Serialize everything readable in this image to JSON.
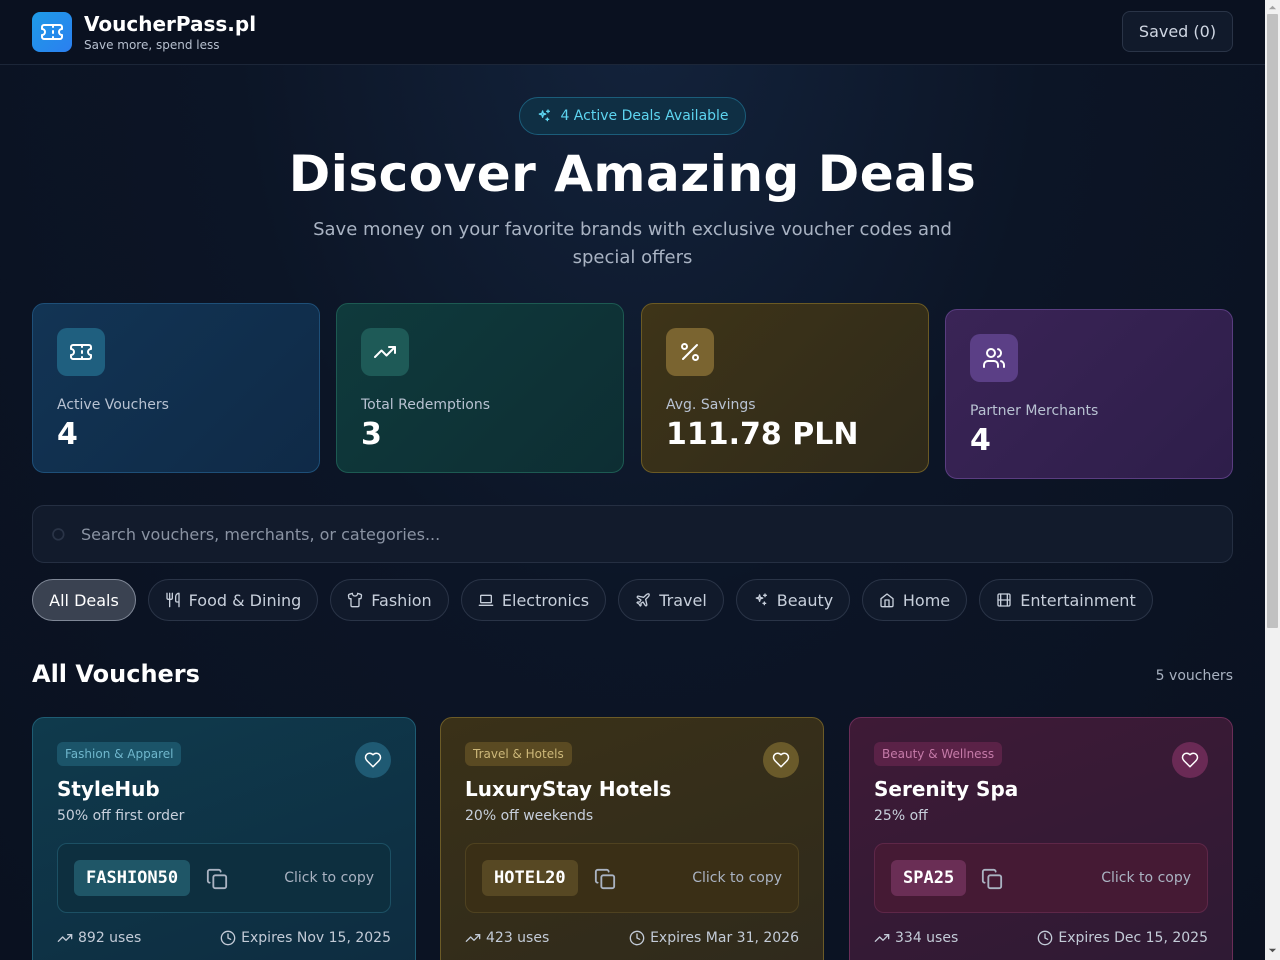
{
  "header": {
    "brand_name": "VoucherPass.pl",
    "tagline": "Save more, spend less",
    "saved_label": "Saved (0)",
    "logo_icon": "ticket-icon"
  },
  "hero": {
    "pill_label": "4 Active Deals Available",
    "title": "Discover Amazing Deals",
    "subtitle": "Save money on your favorite brands with exclusive voucher codes and special offers"
  },
  "stats": [
    {
      "label": "Active Vouchers",
      "value": "4",
      "icon": "ticket-icon"
    },
    {
      "label": "Total Redemptions",
      "value": "3",
      "icon": "trending-up-icon"
    },
    {
      "label": "Avg. Savings",
      "value": "111.78 PLN",
      "icon": "percent-icon"
    },
    {
      "label": "Partner Merchants",
      "value": "4",
      "icon": "users-icon"
    }
  ],
  "search": {
    "placeholder": "Search vouchers, merchants, or categories...",
    "value": ""
  },
  "categories": [
    {
      "label": "All Deals",
      "icon": "",
      "active": true
    },
    {
      "label": "Food & Dining",
      "icon": "utensils-icon"
    },
    {
      "label": "Fashion",
      "icon": "shirt-icon"
    },
    {
      "label": "Electronics",
      "icon": "laptop-icon"
    },
    {
      "label": "Travel",
      "icon": "plane-icon"
    },
    {
      "label": "Beauty",
      "icon": "sparkles-icon"
    },
    {
      "label": "Home",
      "icon": "home-icon"
    },
    {
      "label": "Entertainment",
      "icon": "film-icon"
    }
  ],
  "vouchers_section": {
    "title": "All Vouchers",
    "count": "5 vouchers"
  },
  "vouchers": [
    {
      "category": "Fashion & Apparel",
      "merchant": "StyleHub",
      "offer": "50% off first order",
      "code": "FASHION50",
      "copy_hint": "Click to copy",
      "uses": "892 uses",
      "expires": "Expires Nov 15, 2025"
    },
    {
      "category": "Travel & Hotels",
      "merchant": "LuxuryStay Hotels",
      "offer": "20% off weekends",
      "code": "HOTEL20",
      "copy_hint": "Click to copy",
      "uses": "423 uses",
      "expires": "Expires Mar 31, 2026"
    },
    {
      "category": "Beauty & Wellness",
      "merchant": "Serenity Spa",
      "offer": "25% off",
      "code": "SPA25",
      "copy_hint": "Click to copy",
      "uses": "334 uses",
      "expires": "Expires Dec 15, 2025"
    }
  ],
  "colors": {
    "accent_cyan": "#5dd4f0",
    "logo_blue": "#1e9be6",
    "background": "#0c1526"
  }
}
